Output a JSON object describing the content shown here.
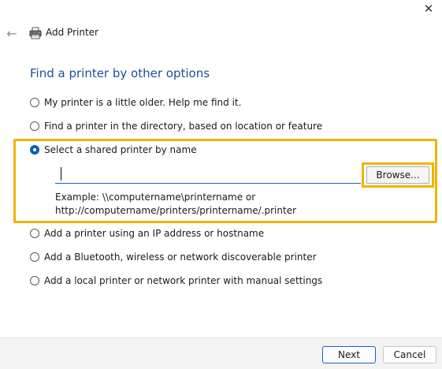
{
  "window": {
    "close_glyph": "✕"
  },
  "header": {
    "back_glyph": "←",
    "title": "Add Printer",
    "icon": "printer-icon"
  },
  "page_title": "Find a printer by other options",
  "options": [
    {
      "label": "My printer is a little older. Help me find it.",
      "checked": false
    },
    {
      "label": "Find a printer in the directory, based on location or feature",
      "checked": false
    },
    {
      "label": "Select a shared printer by name",
      "checked": true
    },
    {
      "label": "Add a printer using an IP address or hostname",
      "checked": false
    },
    {
      "label": "Add a Bluetooth, wireless or network discoverable printer",
      "checked": false
    },
    {
      "label": "Add a local printer or network printer with manual settings",
      "checked": false
    }
  ],
  "shared_printer": {
    "input_value": "",
    "browse_label": "Browse...",
    "example_line1": "Example: \\\\computername\\printername or",
    "example_line2": "http://computername/printers/printername/.printer"
  },
  "footer": {
    "next_label": "Next",
    "cancel_label": "Cancel"
  },
  "colors": {
    "title_blue": "#1f4e99",
    "highlight": "#f0b400",
    "radio_selected": "#0a5fb4"
  }
}
